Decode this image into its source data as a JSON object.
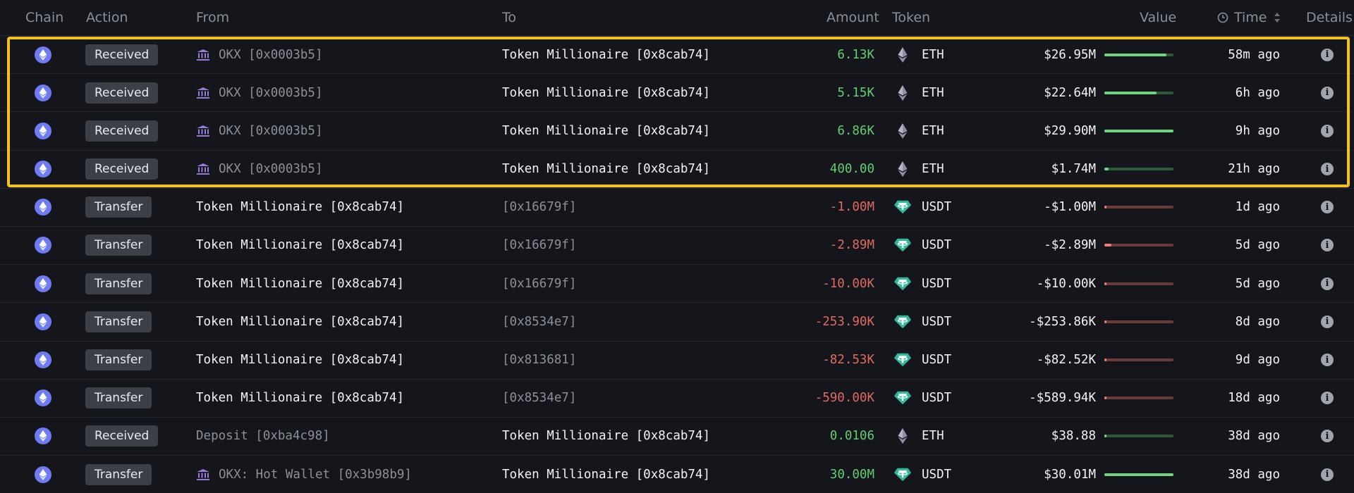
{
  "headers": {
    "chain": "Chain",
    "action": "Action",
    "from": "From",
    "to": "To",
    "amount": "Amount",
    "token": "Token",
    "value": "Value",
    "time": "Time",
    "details": "Details"
  },
  "icons": {
    "chain": "ethereum-icon",
    "exchange": "bank-icon",
    "eth": "eth-diamond-icon",
    "usdt": "tether-icon",
    "info": "info-icon",
    "clock": "clock-icon",
    "sort": "sort-icon"
  },
  "colors": {
    "highlight": "#f2c21a",
    "positive": "#5fcf72",
    "negative": "#e06a62",
    "eth_chain": "#6f7bf2",
    "usdt": "#2fb89a"
  },
  "rows": [
    {
      "action": "Received",
      "from": "OKX [0x0003b5]",
      "from_icon": true,
      "from_style": "dim",
      "to": "Token Millionaire [0x8cab74]",
      "to_style": "white",
      "amount": "6.13K",
      "sign": "pos",
      "token": "ETH",
      "value": "$26.95M",
      "bar_fraction": 0.9,
      "time": "58m ago"
    },
    {
      "action": "Received",
      "from": "OKX [0x0003b5]",
      "from_icon": true,
      "from_style": "dim",
      "to": "Token Millionaire [0x8cab74]",
      "to_style": "white",
      "amount": "5.15K",
      "sign": "pos",
      "token": "ETH",
      "value": "$22.64M",
      "bar_fraction": 0.76,
      "time": "6h ago"
    },
    {
      "action": "Received",
      "from": "OKX [0x0003b5]",
      "from_icon": true,
      "from_style": "dim",
      "to": "Token Millionaire [0x8cab74]",
      "to_style": "white",
      "amount": "6.86K",
      "sign": "pos",
      "token": "ETH",
      "value": "$29.90M",
      "bar_fraction": 1.0,
      "time": "9h ago"
    },
    {
      "action": "Received",
      "from": "OKX [0x0003b5]",
      "from_icon": true,
      "from_style": "dim",
      "to": "Token Millionaire [0x8cab74]",
      "to_style": "white",
      "amount": "400.00",
      "sign": "pos",
      "token": "ETH",
      "value": "$1.74M",
      "bar_fraction": 0.06,
      "time": "21h ago"
    },
    {
      "action": "Transfer",
      "from": "Token Millionaire [0x8cab74]",
      "from_icon": false,
      "from_style": "white",
      "to": "[0x16679f]",
      "to_style": "dim",
      "amount": "-1.00M",
      "sign": "neg",
      "token": "USDT",
      "value": "-$1.00M",
      "bar_fraction": 0.03,
      "time": "1d ago"
    },
    {
      "action": "Transfer",
      "from": "Token Millionaire [0x8cab74]",
      "from_icon": false,
      "from_style": "white",
      "to": "[0x16679f]",
      "to_style": "dim",
      "amount": "-2.89M",
      "sign": "neg",
      "token": "USDT",
      "value": "-$2.89M",
      "bar_fraction": 0.1,
      "time": "5d ago"
    },
    {
      "action": "Transfer",
      "from": "Token Millionaire [0x8cab74]",
      "from_icon": false,
      "from_style": "white",
      "to": "[0x16679f]",
      "to_style": "dim",
      "amount": "-10.00K",
      "sign": "neg",
      "token": "USDT",
      "value": "-$10.00K",
      "bar_fraction": 0.0,
      "time": "5d ago"
    },
    {
      "action": "Transfer",
      "from": "Token Millionaire [0x8cab74]",
      "from_icon": false,
      "from_style": "white",
      "to": "[0x8534e7]",
      "to_style": "dim",
      "amount": "-253.90K",
      "sign": "neg",
      "token": "USDT",
      "value": "-$253.86K",
      "bar_fraction": 0.01,
      "time": "8d ago"
    },
    {
      "action": "Transfer",
      "from": "Token Millionaire [0x8cab74]",
      "from_icon": false,
      "from_style": "white",
      "to": "[0x813681]",
      "to_style": "dim",
      "amount": "-82.53K",
      "sign": "neg",
      "token": "USDT",
      "value": "-$82.52K",
      "bar_fraction": 0.0,
      "time": "9d ago"
    },
    {
      "action": "Transfer",
      "from": "Token Millionaire [0x8cab74]",
      "from_icon": false,
      "from_style": "white",
      "to": "[0x8534e7]",
      "to_style": "dim",
      "amount": "-590.00K",
      "sign": "neg",
      "token": "USDT",
      "value": "-$589.94K",
      "bar_fraction": 0.02,
      "time": "18d ago"
    },
    {
      "action": "Received",
      "from": "Deposit [0xba4c98]",
      "from_icon": false,
      "from_style": "dim",
      "to": "Token Millionaire [0x8cab74]",
      "to_style": "white",
      "amount": "0.0106",
      "sign": "pos",
      "token": "ETH",
      "value": "$38.88",
      "bar_fraction": 0.0,
      "time": "38d ago"
    },
    {
      "action": "Transfer",
      "from": "OKX: Hot Wallet [0x3b98b9]",
      "from_icon": true,
      "from_style": "dim",
      "to": "Token Millionaire [0x8cab74]",
      "to_style": "white",
      "amount": "30.00M",
      "sign": "pos",
      "token": "USDT",
      "value": "$30.01M",
      "bar_fraction": 1.0,
      "time": "38d ago"
    }
  ]
}
